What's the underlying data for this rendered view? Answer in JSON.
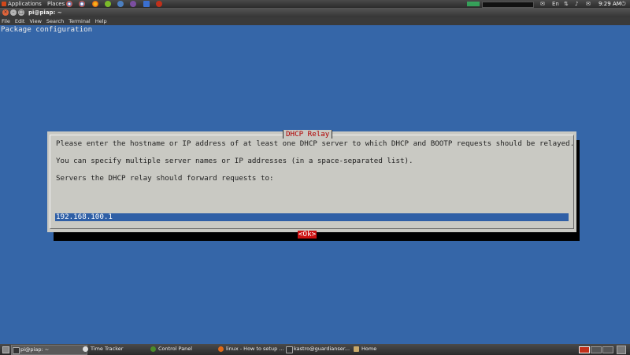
{
  "top_panel": {
    "applications": "Applications",
    "places": "Places",
    "clock": "9:29 AM",
    "keyboard": "En"
  },
  "window": {
    "title": "pi@piap: ~",
    "menu": [
      "File",
      "Edit",
      "View",
      "Search",
      "Terminal",
      "Help"
    ]
  },
  "terminal": {
    "header": "Package configuration"
  },
  "dialog": {
    "title": "DHCP Relay",
    "line1": "Please enter the hostname or IP address of at least one DHCP server to which DHCP and BOOTP requests should be relayed.",
    "line2": "You can specify multiple server names or IP addresses (in a space-separated list).",
    "line3": "Servers the DHCP relay should forward requests to:",
    "input_value": "192.168.100.1",
    "ok_label": "<Ok>"
  },
  "taskbar": {
    "items": [
      {
        "label": "pi@piap: ~",
        "icon": "terminal-icon"
      },
      {
        "label": "Time Tracker",
        "icon": "clock-icon"
      },
      {
        "label": "Control Panel",
        "icon": "control-panel-icon"
      },
      {
        "label": "linux - How to setup ...",
        "icon": "firefox-icon"
      },
      {
        "label": "kastro@guardianser...",
        "icon": "terminal-icon"
      },
      {
        "label": "Home",
        "icon": "folder-icon"
      }
    ]
  },
  "colors": {
    "terminal_bg": "#3566a8",
    "dialog_bg": "#c9c9c3",
    "title_red": "#b10000",
    "ok_red": "#cc1111",
    "input_blue": "#2f5fa6"
  }
}
